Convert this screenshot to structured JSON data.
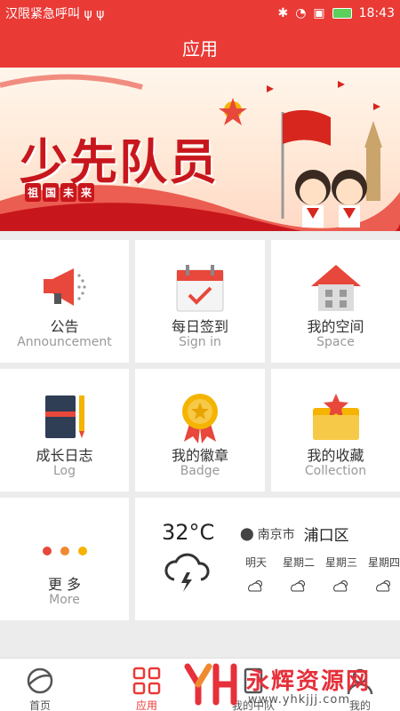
{
  "status_bar": {
    "left_text": "汉限紧急呼叫 ψ ψ",
    "time": "18:43",
    "battery_color": "#5bd05b"
  },
  "title_bar": {
    "title": "应用"
  },
  "banner": {
    "title": "少先队员",
    "subtitle": [
      "祖",
      "国",
      "未",
      "来"
    ]
  },
  "tiles": [
    {
      "cn": "公告",
      "en": "Announcement",
      "icon": "megaphone-icon"
    },
    {
      "cn": "每日签到",
      "en": "Sign in",
      "icon": "calendar-check-icon"
    },
    {
      "cn": "我的空间",
      "en": "Space",
      "icon": "house-icon"
    },
    {
      "cn": "成长日志",
      "en": "Log",
      "icon": "notebook-pencil-icon"
    },
    {
      "cn": "我的徽章",
      "en": "Badge",
      "icon": "medal-icon"
    },
    {
      "cn": "我的收藏",
      "en": "Collection",
      "icon": "folder-star-icon"
    },
    {
      "cn": "更 多",
      "en": "More",
      "icon": "more-dots-icon"
    }
  ],
  "weather": {
    "temperature": "32°C",
    "city": "南京市",
    "district": "浦口区",
    "icon": "thunderstorm-icon",
    "days": [
      "明天",
      "星期二",
      "星期三",
      "星期四"
    ],
    "day_icon": "partly-cloudy-icon"
  },
  "tabs": [
    {
      "label": "首页",
      "icon": "planet-icon"
    },
    {
      "label": "应用",
      "icon": "grid-icon",
      "active": true
    },
    {
      "label": "我的中队",
      "icon": "team-icon"
    },
    {
      "label": "我的",
      "icon": "user-icon"
    }
  ],
  "watermark": {
    "title": "永辉资源网",
    "url": "www.yhkjjj.com"
  },
  "colors": {
    "brand_red": "#e93a36",
    "card_bg": "#ffffff",
    "page_bg": "#ececec"
  }
}
